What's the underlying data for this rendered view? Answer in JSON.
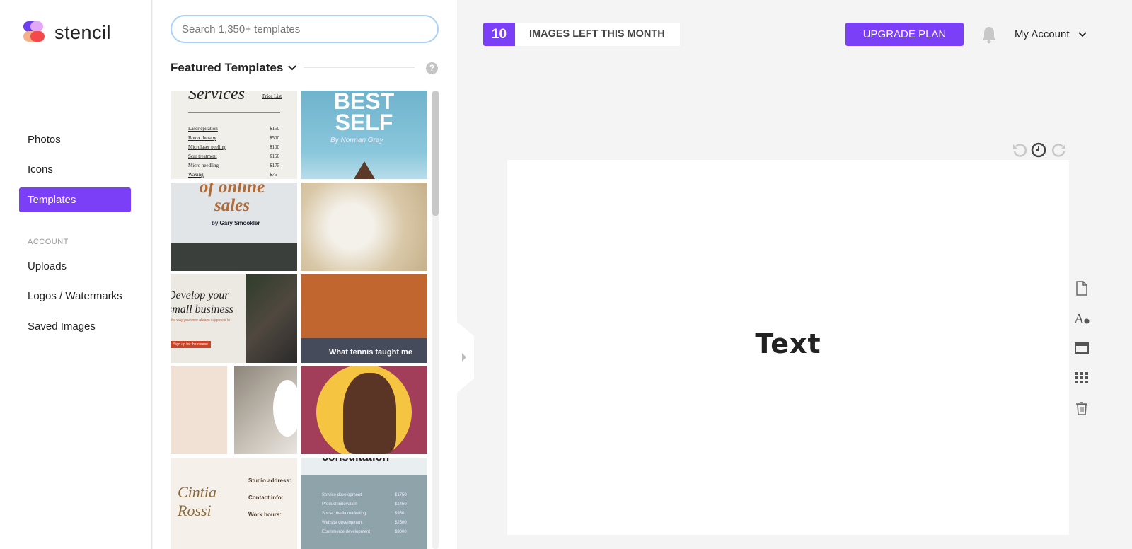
{
  "app": {
    "name": "stencil",
    "brand_color": "#7b3ff7"
  },
  "sidebar": {
    "items": [
      {
        "label": "Photos"
      },
      {
        "label": "Icons"
      },
      {
        "label": "Templates",
        "active": true
      }
    ],
    "account_section": "ACCOUNT",
    "account_items": [
      {
        "label": "Uploads"
      },
      {
        "label": "Logos / Watermarks"
      },
      {
        "label": "Saved Images"
      }
    ]
  },
  "templates_panel": {
    "search_placeholder": "Search 1,350+ templates",
    "heading": "Featured Templates",
    "help_icon": "?",
    "templates": [
      {
        "title": "Services",
        "sub": "Price List",
        "rows": [
          [
            "Laser epilation",
            "$150"
          ],
          [
            "Botox therapy",
            "$500"
          ],
          [
            "Microlaser peeling",
            "$100"
          ],
          [
            "Scar treatment",
            "$150"
          ],
          [
            "Micro needling",
            "$175"
          ],
          [
            "Waxing",
            "$75"
          ]
        ]
      },
      {
        "title": "BEST SELF",
        "sub": "By Norman Gray"
      },
      {
        "title": "of online sales",
        "sub": "by Gary Smookler"
      },
      {
        "title": ""
      },
      {
        "title": "Develop your small business",
        "sub": "the way you were always supposed to",
        "button": "Sign up for the course"
      },
      {
        "title": "What tennis taught me"
      },
      {
        "title": ""
      },
      {
        "title": ""
      },
      {
        "title": "Cintia Rossi",
        "fields": [
          "Studio address:",
          "Contact info:",
          "Work hours:"
        ]
      },
      {
        "title": "consultation",
        "rows": [
          [
            "Service development",
            "$1750"
          ],
          [
            "Product innovation",
            "$1450"
          ],
          [
            "Social media marketing",
            "$950"
          ],
          [
            "Website development",
            "$2500"
          ],
          [
            "Ecommerce development",
            "$3000"
          ]
        ]
      }
    ]
  },
  "topbar": {
    "images_left": "10",
    "images_left_label": "IMAGES LEFT THIS MONTH",
    "upgrade_label": "UPGRADE PLAN",
    "account_label": "My Account"
  },
  "canvas": {
    "text": "Text"
  }
}
